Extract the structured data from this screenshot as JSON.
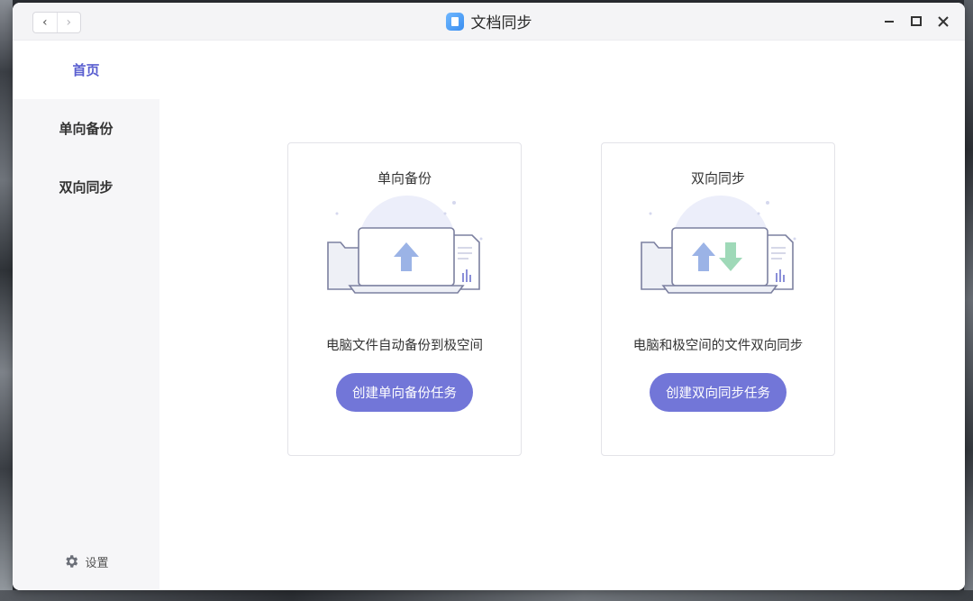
{
  "window": {
    "title": "文档同步",
    "nav_back": "‹",
    "nav_forward": "›"
  },
  "sidebar": {
    "items": [
      {
        "label": "首页",
        "active": true
      },
      {
        "label": "单向备份",
        "active": false
      },
      {
        "label": "双向同步",
        "active": false
      }
    ],
    "settings_label": "设置"
  },
  "cards": [
    {
      "title": "单向备份",
      "description": "电脑文件自动备份到极空间",
      "button_label": "创建单向备份任务",
      "icon": "upload-icon"
    },
    {
      "title": "双向同步",
      "description": "电脑和极空间的文件双向同步",
      "button_label": "创建双向同步任务",
      "icon": "two-way-sync-icon"
    }
  ],
  "colors": {
    "accent": "#7276d8",
    "active_nav": "#5a5fd0",
    "upload_arrow": "#9bb3e6",
    "download_arrow": "#9fd9b8"
  }
}
